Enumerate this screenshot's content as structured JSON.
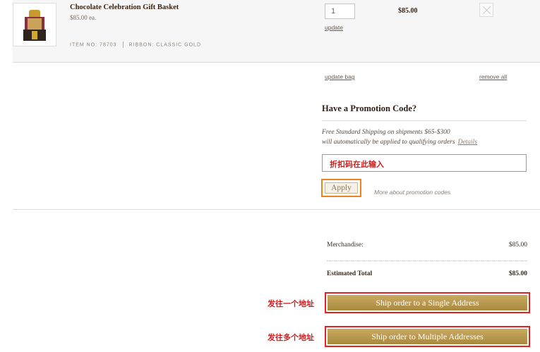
{
  "cart": {
    "item": {
      "name": "Chocolate Celebration Gift Basket",
      "price_each": "$85.00 ea.",
      "item_no": "ITEM NO: 78703",
      "ribbon": "RIBBON: CLASSIC GOLD",
      "quantity": "1",
      "update_label": "update",
      "line_total": "$85.00",
      "thumbnail_icon": "gift-basket-image"
    },
    "update_bag_label": "update bag",
    "remove_all_label": "remove all"
  },
  "promo": {
    "title": "Have a Promotion Code?",
    "shipping_line1": "Free Standard Shipping on shipments $65-$300",
    "shipping_line2": "will automatically be applied to qualifying orders",
    "details_label": "Details",
    "input_hint": "折扣码在此输入",
    "apply_label": "Apply",
    "more_label": "More about promotion codes"
  },
  "summary": {
    "merchandise_label": "Merchandise:",
    "merchandise_value": "$85.00",
    "total_label": "Estimated Total",
    "total_value": "$85.00"
  },
  "shipping": {
    "single_annotation": "发往一个地址",
    "single_label": "Ship order to a Single Address",
    "multi_annotation": "发往多个地址",
    "multi_label": "Ship order to Multiple Addresses"
  },
  "colors": {
    "annotation_red": "#cc1f1f",
    "apply_highlight": "#f0821e",
    "button_gold": "#b8984e"
  }
}
